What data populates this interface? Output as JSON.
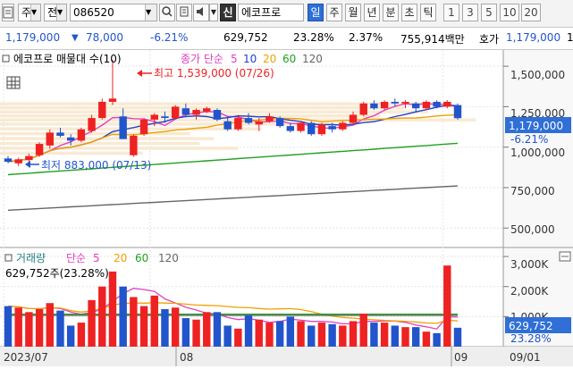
{
  "toolbar": {
    "market": "주",
    "type": "전",
    "code": "086520",
    "badge": "신",
    "stock_name": "에코프로",
    "periods": [
      {
        "label": "일",
        "active": true
      },
      {
        "label": "주",
        "active": false
      },
      {
        "label": "월",
        "active": false
      },
      {
        "label": "년",
        "active": false
      },
      {
        "label": "분",
        "active": false
      },
      {
        "label": "초",
        "active": false
      },
      {
        "label": "틱",
        "active": false
      }
    ],
    "intervals": [
      "1",
      "3",
      "5",
      "10",
      "20"
    ]
  },
  "quote": {
    "price": "1,179,000",
    "change": "78,000",
    "change_pct": "-6.21%",
    "volume": "629,752",
    "vol_ratio": "23.28%",
    "turnover": "2.37%",
    "amount": "755,914백만",
    "ask_label": "호가",
    "ask_price": "1,179,000",
    "ask_tail": "1"
  },
  "price_panel": {
    "title": "에코프로 매물대 수(10)",
    "ma_label": "종가 단순",
    "ma_periods": [
      "5",
      "10",
      "20",
      "60",
      "120"
    ],
    "high_label": "최고 1,539,000 (07/26)",
    "low_label": "최저 883,000 (07/13)",
    "axis_labels": [
      "1,500,000",
      "1,250,000",
      "1,000,000",
      "750,000",
      "500,000"
    ],
    "current_price": "1,179,000",
    "current_change": "-6.21%"
  },
  "volume_panel": {
    "title": "거래량",
    "ma_label": "단순",
    "ma_periods": [
      "5",
      "20",
      "60",
      "120"
    ],
    "current_text": "629,752주(23.28%)",
    "axis_labels": [
      "3,000K",
      "2,000K",
      "1,000K"
    ],
    "current_volume": "629,752",
    "current_pct": "23.28%"
  },
  "date_axis": {
    "labels": [
      "2023/07",
      "08",
      "09",
      "09/01"
    ]
  },
  "colors": {
    "up": "#ee2222",
    "down": "#2255cc",
    "ma5": "#e040c0",
    "ma10": "#2040d0",
    "ma20": "#f0a000",
    "ma60": "#20a020",
    "ma120": "#666666"
  },
  "chart_data": {
    "type": "candlestick",
    "candles": [
      {
        "o": 930000,
        "h": 945000,
        "l": 900000,
        "c": 910000
      },
      {
        "o": 900000,
        "h": 935000,
        "l": 883000,
        "c": 925000
      },
      {
        "o": 920000,
        "h": 960000,
        "l": 905000,
        "c": 945000
      },
      {
        "o": 950000,
        "h": 1030000,
        "l": 940000,
        "c": 1020000
      },
      {
        "o": 1010000,
        "h": 1110000,
        "l": 990000,
        "c": 1090000
      },
      {
        "o": 1090000,
        "h": 1120000,
        "l": 1060000,
        "c": 1070000
      },
      {
        "o": 1060000,
        "h": 1080000,
        "l": 1010000,
        "c": 1040000
      },
      {
        "o": 1040000,
        "h": 1120000,
        "l": 1030000,
        "c": 1110000
      },
      {
        "o": 1100000,
        "h": 1200000,
        "l": 1090000,
        "c": 1180000
      },
      {
        "o": 1180000,
        "h": 1300000,
        "l": 1170000,
        "c": 1280000
      },
      {
        "o": 1280000,
        "h": 1539000,
        "l": 1260000,
        "c": 1300000
      },
      {
        "o": 1190000,
        "h": 1240000,
        "l": 1050000,
        "c": 1050000
      },
      {
        "o": 950000,
        "h": 1080000,
        "l": 940000,
        "c": 1070000
      },
      {
        "o": 1080000,
        "h": 1180000,
        "l": 1070000,
        "c": 1170000
      },
      {
        "o": 1170000,
        "h": 1210000,
        "l": 1130000,
        "c": 1200000
      },
      {
        "o": 1190000,
        "h": 1220000,
        "l": 1150000,
        "c": 1180000
      },
      {
        "o": 1180000,
        "h": 1260000,
        "l": 1170000,
        "c": 1250000
      },
      {
        "o": 1240000,
        "h": 1270000,
        "l": 1190000,
        "c": 1200000
      },
      {
        "o": 1200000,
        "h": 1240000,
        "l": 1170000,
        "c": 1230000
      },
      {
        "o": 1220000,
        "h": 1250000,
        "l": 1210000,
        "c": 1240000
      },
      {
        "o": 1230000,
        "h": 1240000,
        "l": 1160000,
        "c": 1170000
      },
      {
        "o": 1160000,
        "h": 1190000,
        "l": 1100000,
        "c": 1110000
      },
      {
        "o": 1110000,
        "h": 1200000,
        "l": 1100000,
        "c": 1180000
      },
      {
        "o": 1180000,
        "h": 1210000,
        "l": 1140000,
        "c": 1150000
      },
      {
        "o": 1140000,
        "h": 1180000,
        "l": 1100000,
        "c": 1160000
      },
      {
        "o": 1160000,
        "h": 1210000,
        "l": 1150000,
        "c": 1190000
      },
      {
        "o": 1180000,
        "h": 1190000,
        "l": 1120000,
        "c": 1130000
      },
      {
        "o": 1130000,
        "h": 1150000,
        "l": 1090000,
        "c": 1100000
      },
      {
        "o": 1100000,
        "h": 1160000,
        "l": 1090000,
        "c": 1150000
      },
      {
        "o": 1150000,
        "h": 1160000,
        "l": 1070000,
        "c": 1080000
      },
      {
        "o": 1080000,
        "h": 1150000,
        "l": 1070000,
        "c": 1140000
      },
      {
        "o": 1130000,
        "h": 1150000,
        "l": 1090000,
        "c": 1110000
      },
      {
        "o": 1110000,
        "h": 1160000,
        "l": 1100000,
        "c": 1150000
      },
      {
        "o": 1150000,
        "h": 1220000,
        "l": 1140000,
        "c": 1200000
      },
      {
        "o": 1200000,
        "h": 1280000,
        "l": 1190000,
        "c": 1270000
      },
      {
        "o": 1270000,
        "h": 1290000,
        "l": 1230000,
        "c": 1240000
      },
      {
        "o": 1240000,
        "h": 1290000,
        "l": 1230000,
        "c": 1280000
      },
      {
        "o": 1280000,
        "h": 1300000,
        "l": 1250000,
        "c": 1270000
      },
      {
        "o": 1270000,
        "h": 1290000,
        "l": 1240000,
        "c": 1280000
      },
      {
        "o": 1270000,
        "h": 1280000,
        "l": 1220000,
        "c": 1240000
      },
      {
        "o": 1240000,
        "h": 1290000,
        "l": 1230000,
        "c": 1280000
      },
      {
        "o": 1280000,
        "h": 1290000,
        "l": 1240000,
        "c": 1250000
      },
      {
        "o": 1250000,
        "h": 1290000,
        "l": 1240000,
        "c": 1280000
      },
      {
        "o": 1260000,
        "h": 1270000,
        "l": 1170000,
        "c": 1179000
      }
    ],
    "volumes_k": [
      1350,
      1300,
      1150,
      1250,
      1450,
      1200,
      700,
      800,
      1550,
      2000,
      2500,
      2000,
      1650,
      1350,
      1700,
      1250,
      1300,
      950,
      900,
      1150,
      1150,
      700,
      600,
      1050,
      900,
      800,
      850,
      1000,
      850,
      700,
      800,
      750,
      700,
      850,
      1100,
      800,
      800,
      700,
      650,
      650,
      500,
      450,
      2700,
      629.752
    ],
    "price_axis": {
      "min": 380000,
      "max": 1600000,
      "ticks": [
        1500000,
        1250000,
        1000000,
        750000,
        500000
      ]
    },
    "volume_axis": {
      "min": 0,
      "max": 3300,
      "ticks": [
        3000,
        2000,
        1000
      ],
      "unit": "K"
    },
    "x_labels": [
      {
        "index": 0,
        "label": "2023/07"
      },
      {
        "index": 14,
        "label": "08"
      },
      {
        "index": 42,
        "label": "09"
      }
    ],
    "volume_profile": [
      {
        "price": 1265000,
        "size": 0.95
      },
      {
        "price": 1240000,
        "size": 0.85
      },
      {
        "price": 1215000,
        "size": 0.9
      },
      {
        "price": 1190000,
        "size": 0.8
      },
      {
        "price": 1165000,
        "size": 1.0
      },
      {
        "price": 1140000,
        "size": 0.75
      },
      {
        "price": 1110000,
        "size": 0.55
      },
      {
        "price": 1080000,
        "size": 0.4
      },
      {
        "price": 1050000,
        "size": 0.45
      },
      {
        "price": 1020000,
        "size": 0.42
      },
      {
        "price": 990000,
        "size": 0.5
      },
      {
        "price": 960000,
        "size": 0.3
      }
    ]
  }
}
